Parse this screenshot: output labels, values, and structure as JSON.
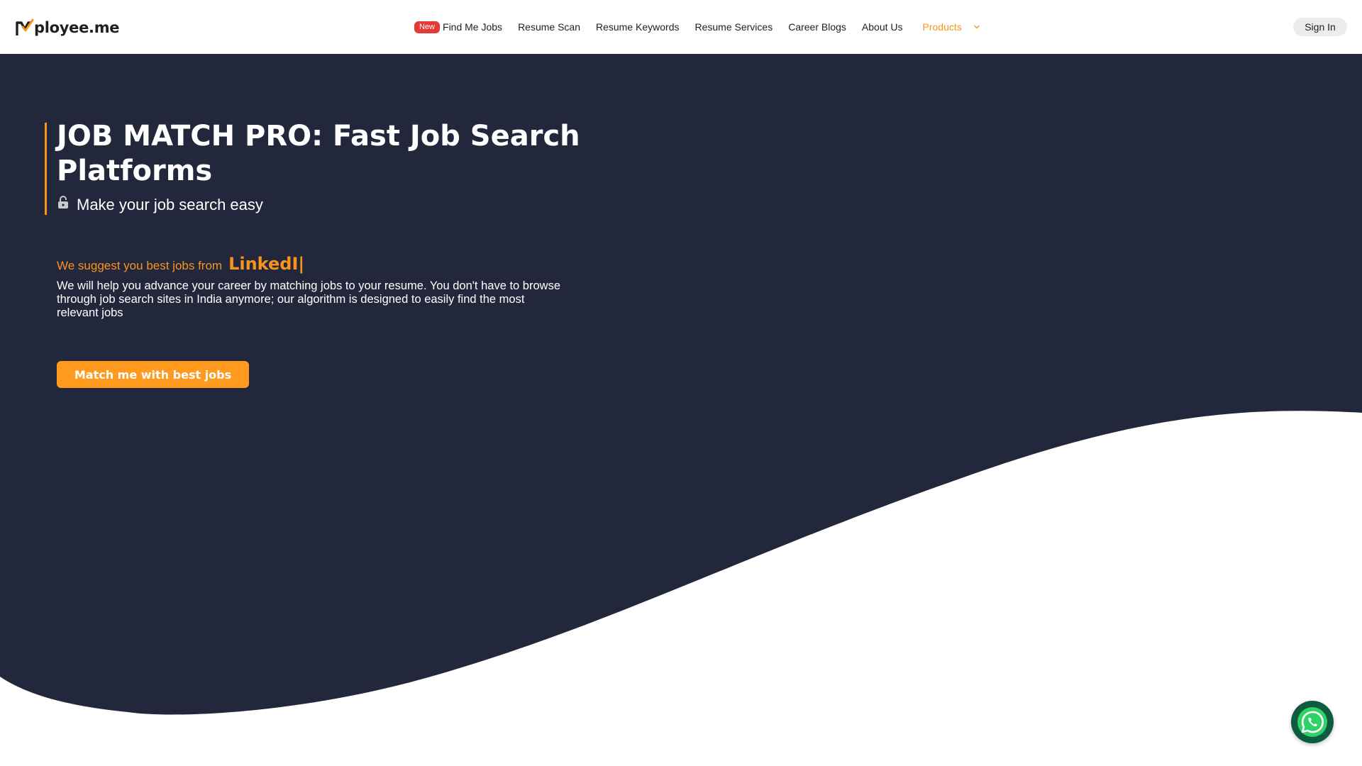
{
  "brand": {
    "name": "Mployee.me",
    "text": "ployee.me"
  },
  "nav": {
    "badge": "New",
    "items": [
      "Find Me Jobs",
      "Resume Scan",
      "Resume Keywords",
      "Resume Services",
      "Career Blogs",
      "About Us"
    ],
    "products": "Products"
  },
  "auth": {
    "sign_in": "Sign In"
  },
  "hero": {
    "title": "JOB MATCH PRO: Fast Job Search Platforms",
    "subtitle": "Make your job search easy",
    "suggest_prefix": "We suggest you best jobs from",
    "suggest_platform": "LinkedI|",
    "description": "We will help you advance your career by matching jobs to your resume. You don't have to browse through job search sites in India anymore; our algorithm is designed to easily find the most relevant jobs",
    "cta": "Match me with best jobs"
  },
  "colors": {
    "accent": "#f7941d",
    "hero_bg": "#23273b",
    "badge": "#e53935",
    "whatsapp": "#0f5b3f"
  },
  "icons": {
    "lock": "lock-icon",
    "chevron": "chevron-down-icon",
    "whatsapp": "whatsapp-icon",
    "logo": "logo-check-icon"
  }
}
